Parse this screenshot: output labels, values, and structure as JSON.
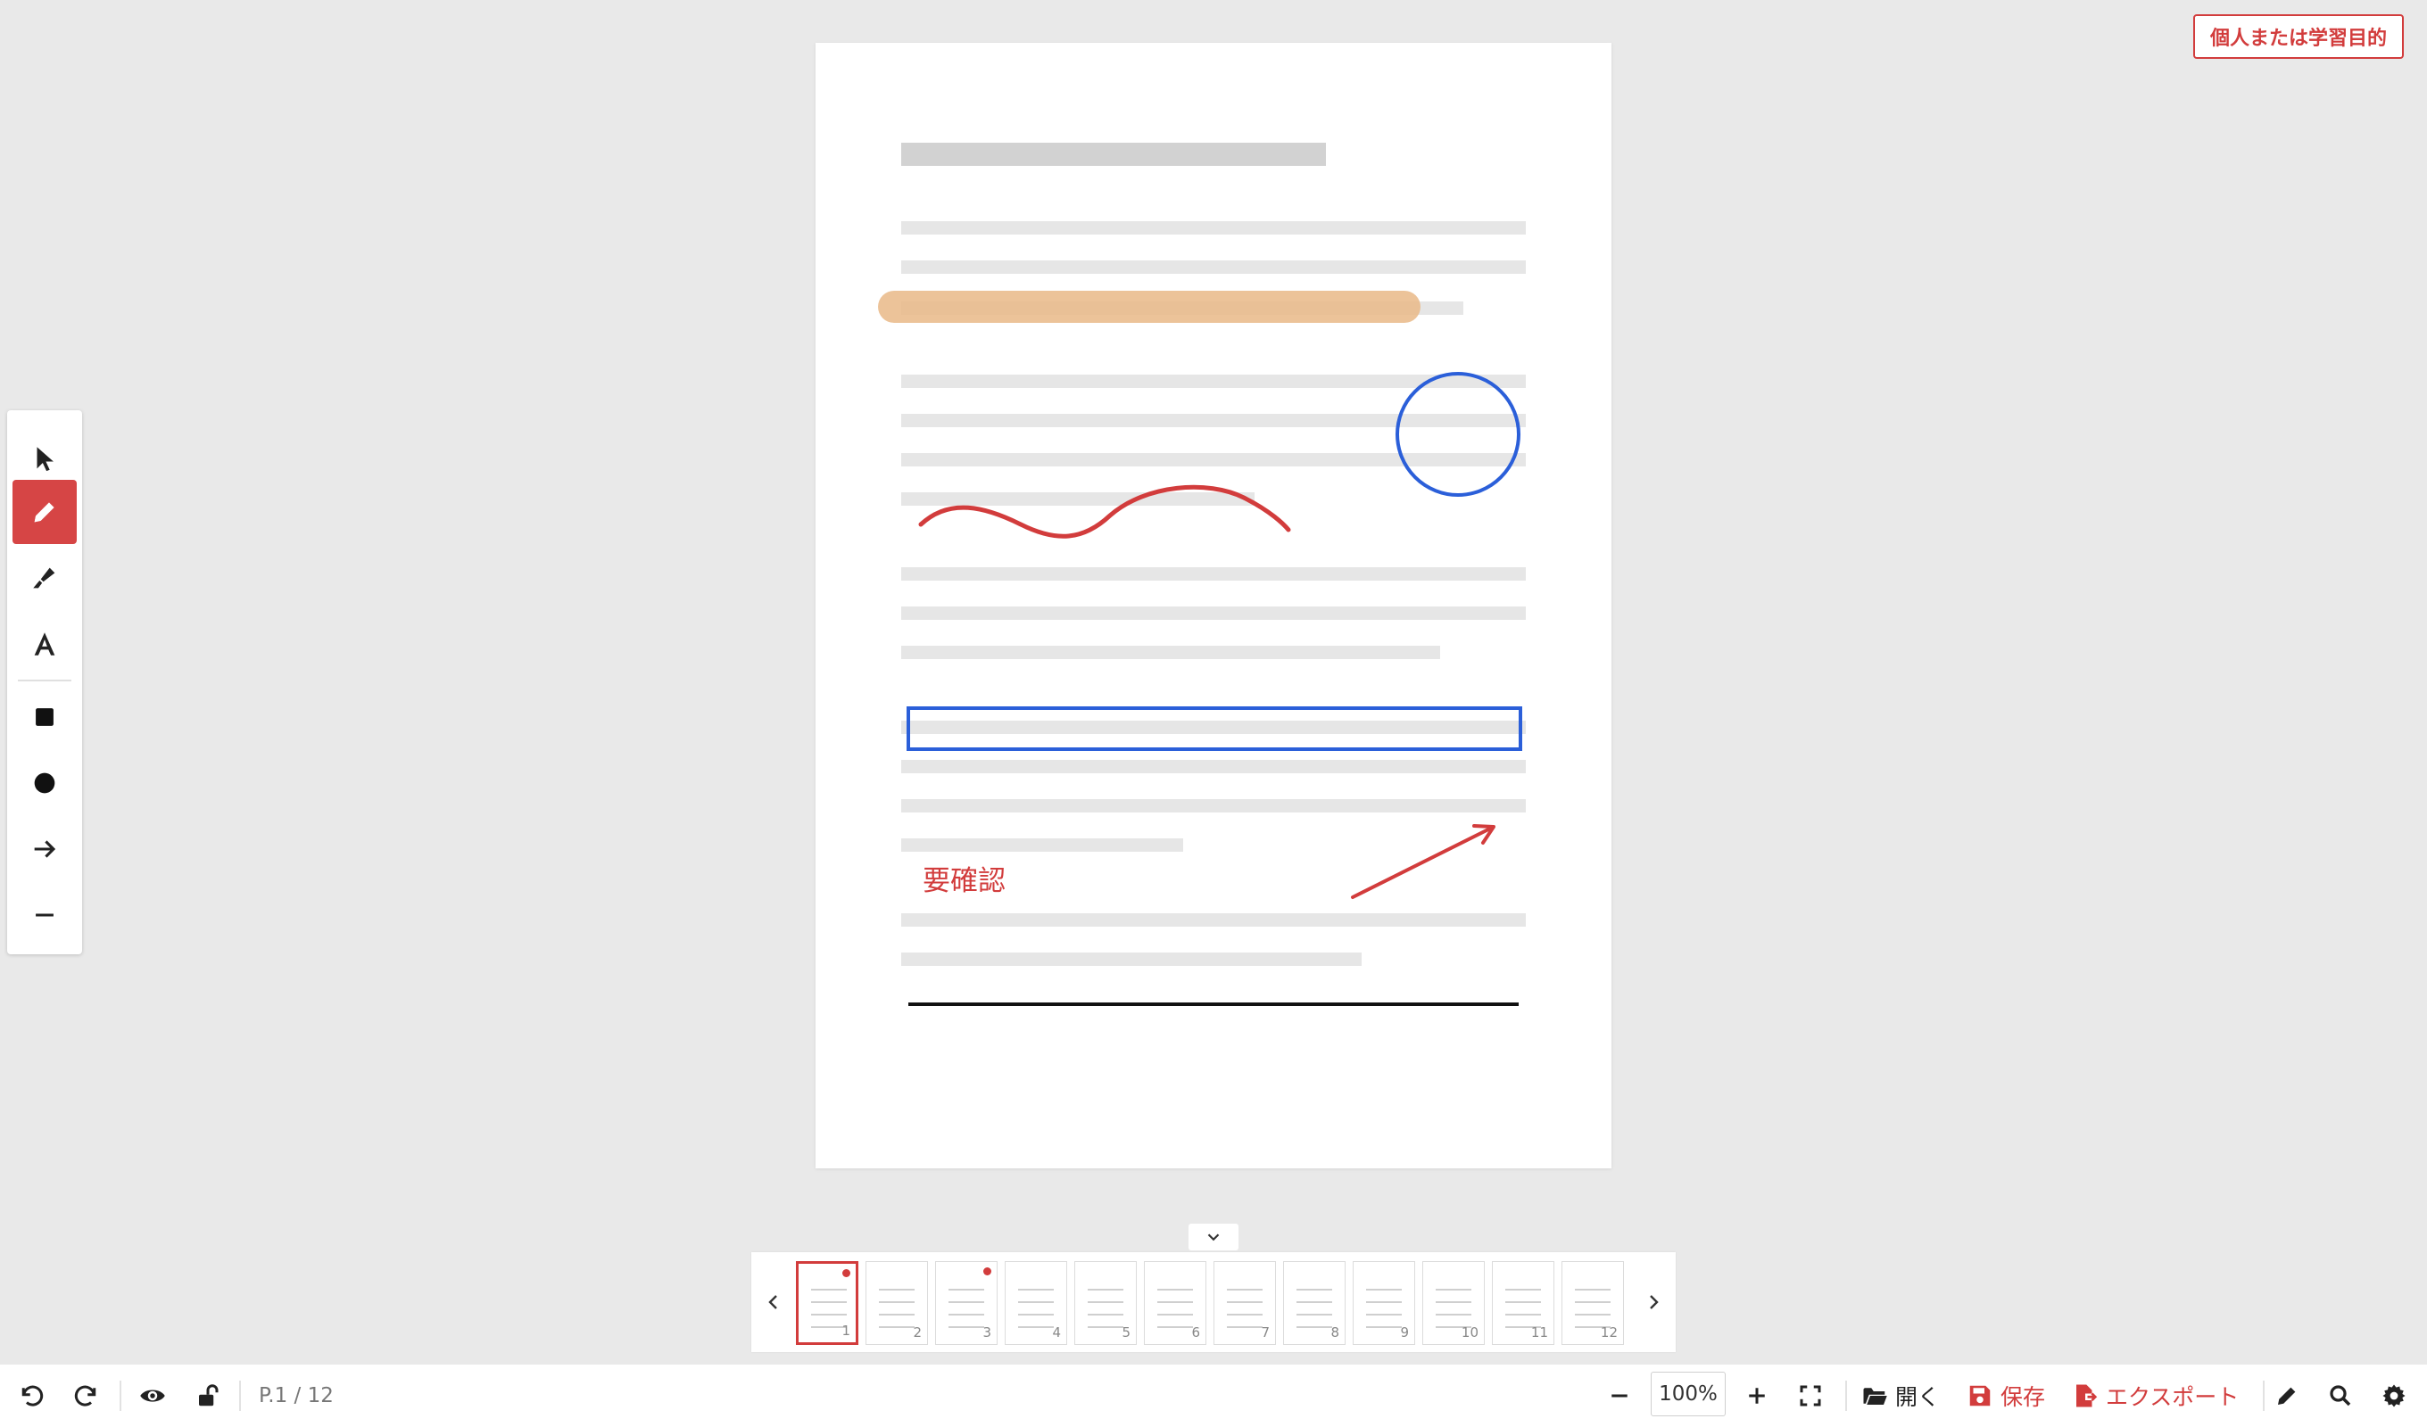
{
  "badge": {
    "label": "個人または学習目的"
  },
  "toolbar": {
    "tools": [
      {
        "name": "select",
        "icon": "cursor-arrow-icon",
        "active": false
      },
      {
        "name": "pen",
        "icon": "pencil-icon",
        "active": true
      },
      {
        "name": "highlighter",
        "icon": "highlighter-icon",
        "active": false
      },
      {
        "name": "text",
        "icon": "text-a-icon",
        "active": false
      },
      {
        "name": "rectangle",
        "icon": "square-icon",
        "active": false
      },
      {
        "name": "ellipse",
        "icon": "circle-icon",
        "active": false
      },
      {
        "name": "arrow",
        "icon": "arrow-right-icon",
        "active": false
      },
      {
        "name": "line",
        "icon": "line-icon",
        "active": false
      }
    ]
  },
  "document": {
    "annotation_note": "要確認",
    "colors": {
      "pen": "#d23c3c",
      "shape": "#2b5fd9",
      "highlight": "#e9b987",
      "line": "#111111"
    }
  },
  "thumbnails": {
    "pages": [
      "1",
      "2",
      "3",
      "4",
      "5",
      "6",
      "7",
      "8",
      "9",
      "10",
      "11",
      "12"
    ],
    "current": 1,
    "annotated_pages": [
      1,
      3
    ]
  },
  "bottombar": {
    "page_indicator": "P.1 / 12",
    "zoom": "100%",
    "open_label": "開く",
    "save_label": "保存",
    "export_label": "エクスポート"
  }
}
